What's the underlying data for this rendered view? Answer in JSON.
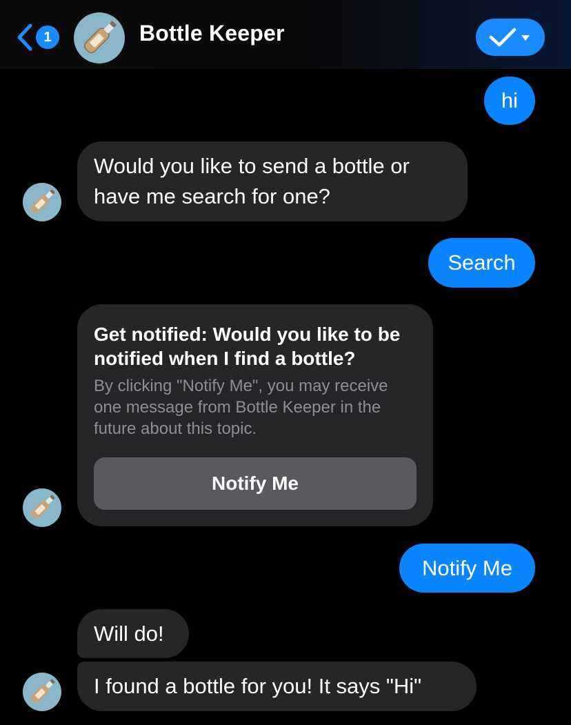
{
  "header": {
    "back_badge": "1",
    "title": "Bottle Keeper",
    "avatar_icon": "message-in-bottle-icon",
    "action_icon": "checkmark-dropdown-icon"
  },
  "colors": {
    "accent": "#0a84ff",
    "incoming_bubble": "#262628",
    "card_button": "#5a5a5e",
    "avatar_bg": "#89b7c9"
  },
  "messages": [
    {
      "from": "user",
      "text": "hi"
    },
    {
      "from": "bot",
      "text": "Would you like to send a bottle or have me search for one?"
    },
    {
      "from": "user",
      "text": "Search"
    },
    {
      "from": "bot",
      "type": "card",
      "title": "Get notified: Would you like to be notified when I find a bottle?",
      "subtitle": "By clicking \"Notify Me\", you may receive one message from Bottle Keeper in the future about this topic.",
      "button": "Notify Me"
    },
    {
      "from": "user",
      "text": "Notify Me"
    },
    {
      "from": "bot",
      "text": "Will do!"
    },
    {
      "from": "bot",
      "text": "I found a bottle for you! It says \"Hi\""
    }
  ]
}
